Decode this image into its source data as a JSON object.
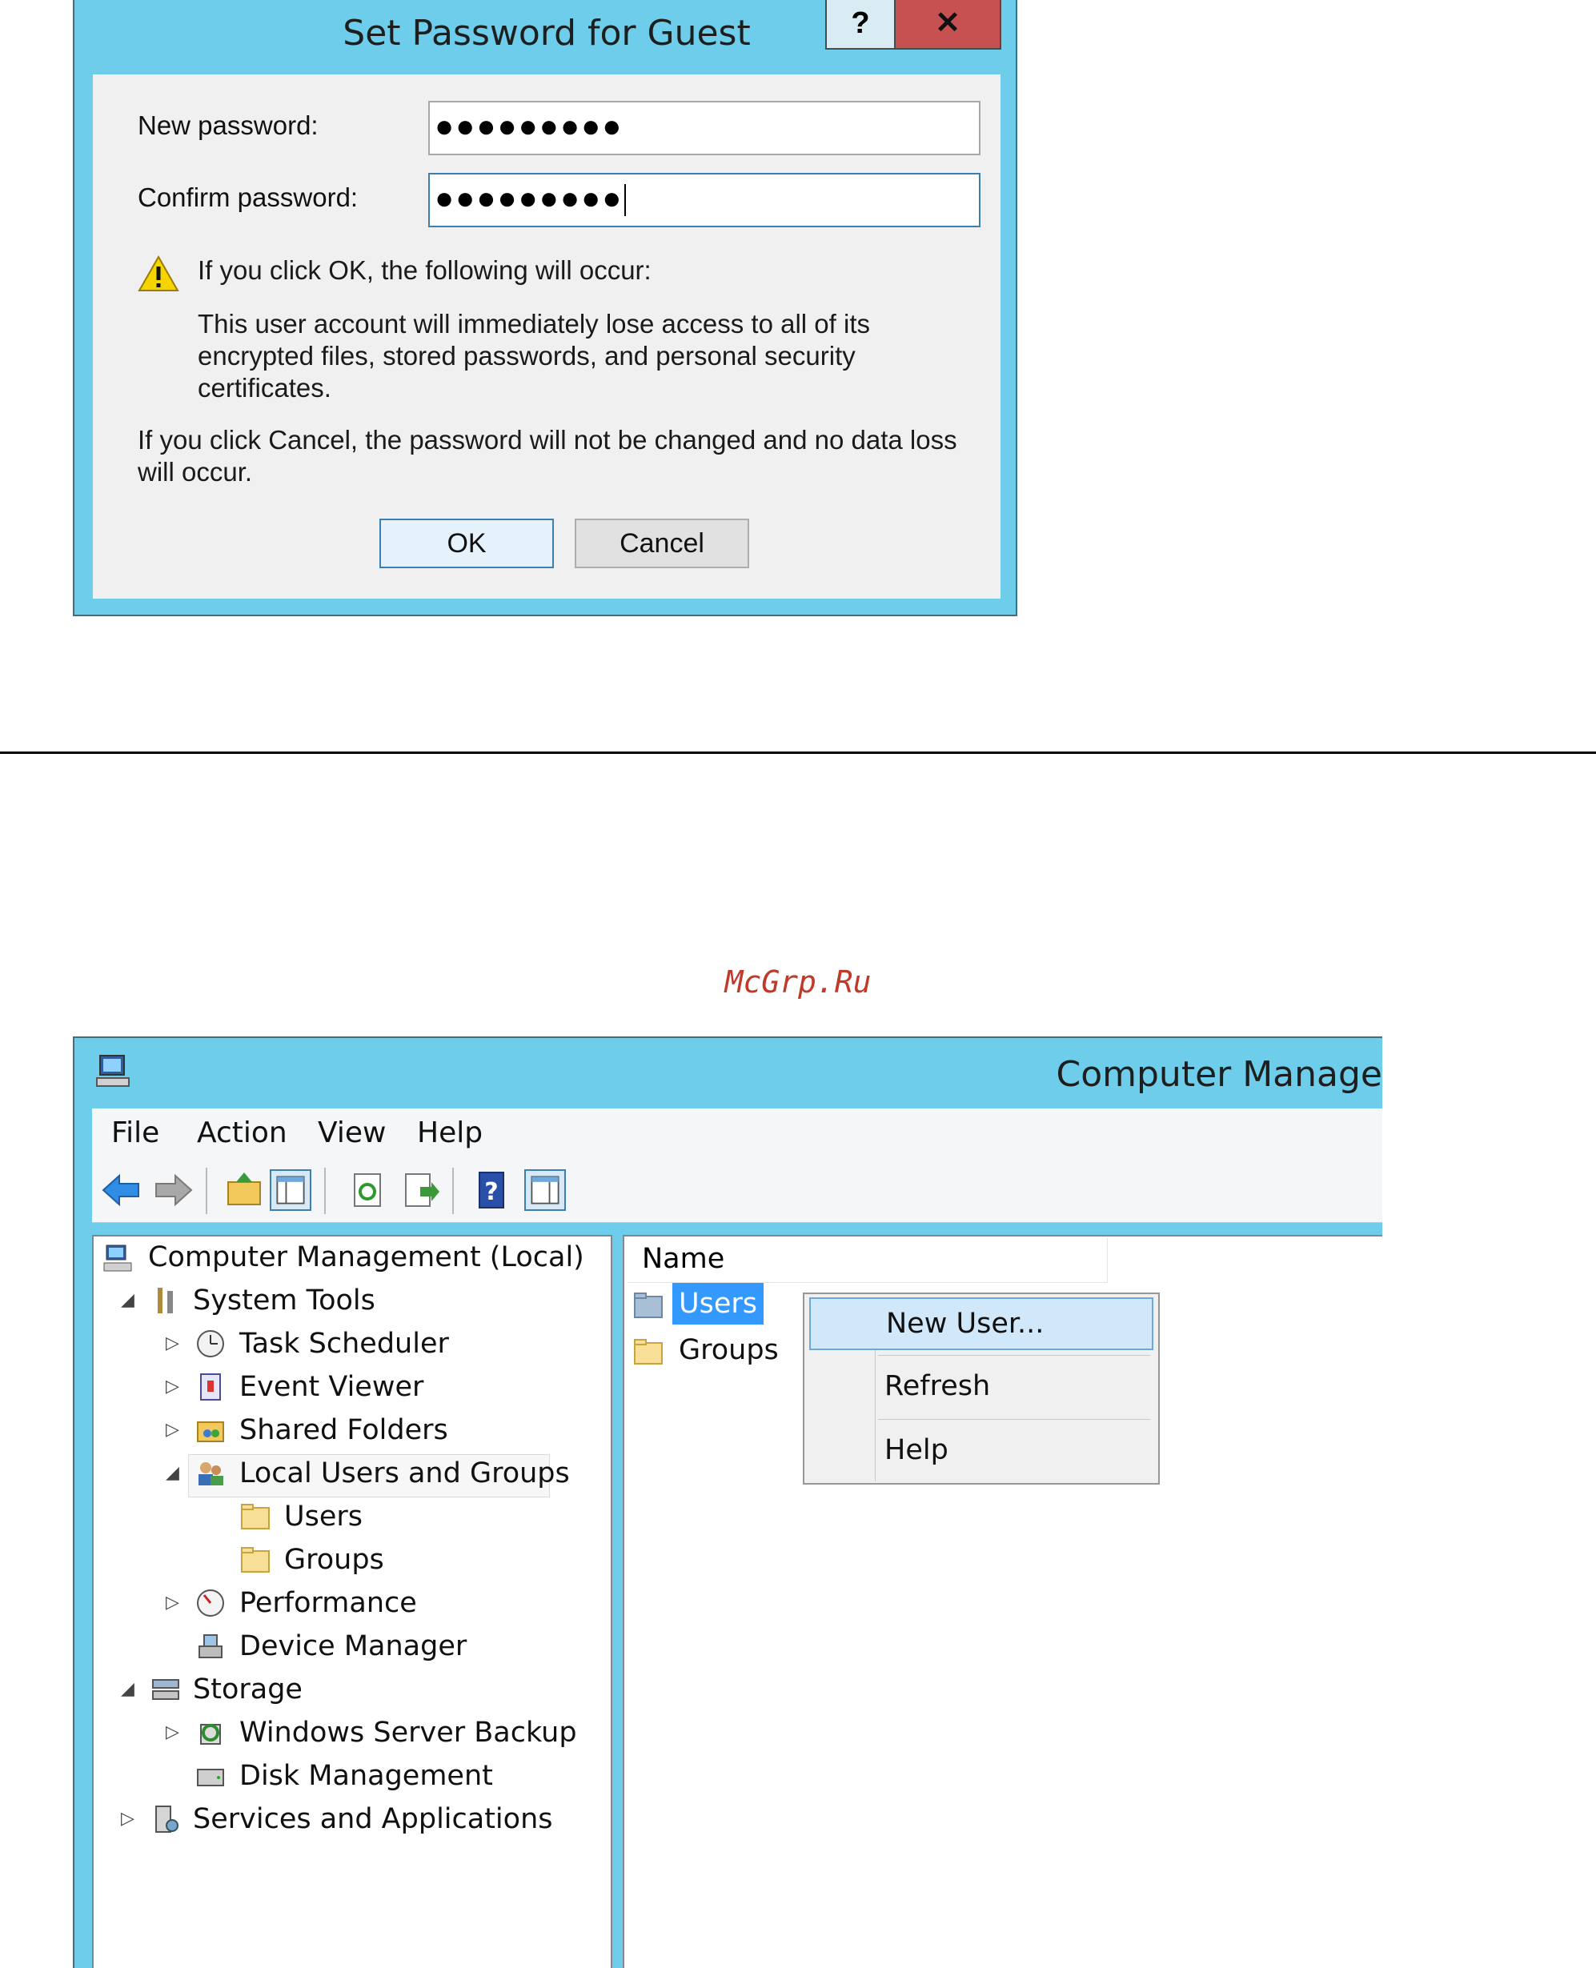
{
  "password_dialog": {
    "title": "Set Password for Guest",
    "help_label": "?",
    "close_label": "✕",
    "new_password_label": "New password:",
    "new_password_value": "●●●●●●●●●",
    "confirm_password_label": "Confirm password:",
    "confirm_password_value": "●●●●●●●●●",
    "warning_heading": "If you click OK, the following will occur:",
    "warning_body": "This user account will immediately lose access to all of its encrypted files, stored passwords, and personal security certificates.",
    "cancel_note": "If you click Cancel, the password will not be changed and no data loss will occur.",
    "ok_label": "OK",
    "cancel_label": "Cancel"
  },
  "watermark": "McGrp.Ru",
  "computer_management": {
    "title": "Computer Manage",
    "menu": [
      "File",
      "Action",
      "View",
      "Help"
    ],
    "toolbar_icons": [
      "back-icon",
      "forward-icon",
      "up-folder-icon",
      "show-hide-tree-icon",
      "refresh-icon",
      "export-list-icon",
      "help-icon",
      "show-hide-action-pane-icon"
    ],
    "tree": [
      {
        "label": "Computer Management (Local)",
        "icon": "computer-management-icon"
      },
      {
        "label": "System Tools",
        "icon": "system-tools-icon"
      },
      {
        "label": "Task Scheduler",
        "icon": "clock-icon"
      },
      {
        "label": "Event Viewer",
        "icon": "event-viewer-icon"
      },
      {
        "label": "Shared Folders",
        "icon": "shared-folders-icon"
      },
      {
        "label": "Local Users and Groups",
        "icon": "users-groups-icon"
      },
      {
        "label": "Users",
        "icon": "folder-icon"
      },
      {
        "label": "Groups",
        "icon": "folder-icon"
      },
      {
        "label": "Performance",
        "icon": "performance-icon"
      },
      {
        "label": "Device Manager",
        "icon": "device-manager-icon"
      },
      {
        "label": "Storage",
        "icon": "storage-icon"
      },
      {
        "label": "Windows Server Backup",
        "icon": "backup-icon"
      },
      {
        "label": "Disk Management",
        "icon": "disk-management-icon"
      },
      {
        "label": "Services and Applications",
        "icon": "services-icon"
      }
    ],
    "list_header": "Name",
    "list_items": [
      "Users",
      "Groups"
    ],
    "context_menu": [
      "New User...",
      "Refresh",
      "Help"
    ],
    "colors": {
      "title_bar": "#6dcdea",
      "selection": "#3399ff",
      "context_highlight": "#d1e8fa"
    }
  }
}
